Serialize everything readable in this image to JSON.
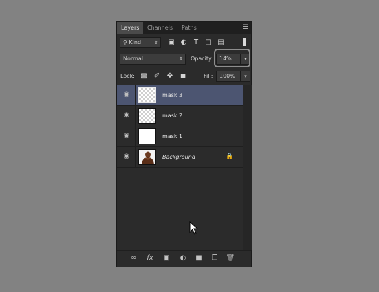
{
  "tabs": [
    "Layers",
    "Channels",
    "Paths"
  ],
  "panel_menu_icon": "panel-menu-icon",
  "filter": {
    "kind_label": "Kind",
    "kind_icon": "search-icon"
  },
  "blend": {
    "mode": "Normal",
    "opacity_label": "Opacity:",
    "opacity_value": "14%"
  },
  "lock": {
    "label": "Lock:",
    "fill_label": "Fill:",
    "fill_value": "100%"
  },
  "layers": [
    {
      "name": "mask 3",
      "selected": true
    },
    {
      "name": "mask 2",
      "selected": false
    },
    {
      "name": "mask 1",
      "selected": false
    },
    {
      "name": "Background",
      "selected": false,
      "locked": true
    }
  ],
  "footer_icons": [
    "link-layers-icon",
    "fx-icon",
    "layer-mask-icon",
    "adjustment-layer-icon",
    "group-folder-icon",
    "new-layer-icon",
    "trash-icon"
  ],
  "colors": {
    "selected_row": "#4c5571",
    "panel_bg": "#2b2b2b",
    "canvas_bg": "#828282"
  }
}
